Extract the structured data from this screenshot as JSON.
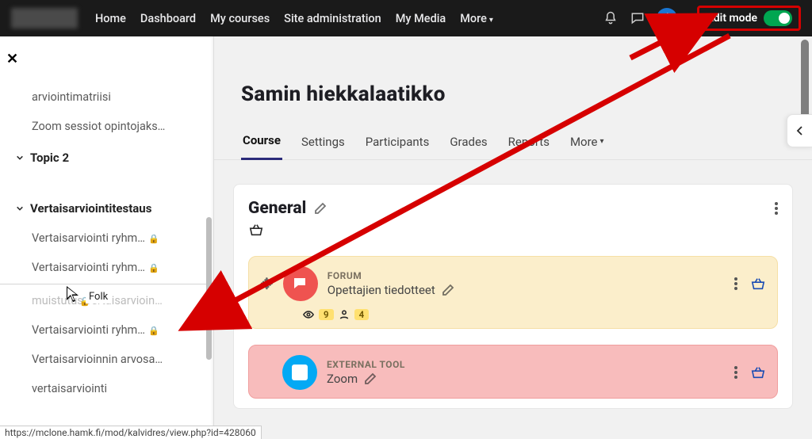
{
  "nav": {
    "home": "Home",
    "dashboard": "Dashboard",
    "my_courses": "My courses",
    "site_admin": "Site administration",
    "my_media": "My Media",
    "more": "More",
    "edit_mode": "Edit mode"
  },
  "sidebar": {
    "items_top": [
      "arviointimatriisi",
      "Zoom sessiot opintojaks…"
    ],
    "sections": {
      "topic2": "Topic 2",
      "vert": "Vertaisarviointitestaus"
    },
    "vert_items": [
      "Vertaisarviointi ryhm…",
      "Vertaisarviointi ryhm…",
      "muistutus vertaisarvioin…",
      "Vertaisarviointi ryhm…",
      "Vertaisarvioinnin arvosa…",
      "vertaisarviointi"
    ],
    "tooltip": "Folk"
  },
  "page": {
    "title": "Samin hiekkalaatikko"
  },
  "tabs": {
    "course": "Course",
    "settings": "Settings",
    "participants": "Participants",
    "grades": "Grades",
    "reports": "Reports",
    "more": "More"
  },
  "section": {
    "title": "General"
  },
  "activities": {
    "forum": {
      "type": "FORUM",
      "title": "Opettajien tiedotteet",
      "views_badge": "9",
      "people_badge": "4"
    },
    "zoom": {
      "type": "EXTERNAL TOOL",
      "title": "Zoom"
    }
  },
  "status_url": "https://mclone.hamk.fi/mod/kalvidres/view.php?id=428060",
  "colors": {
    "accent_red": "#d60000",
    "toggle_green": "#00a651"
  }
}
